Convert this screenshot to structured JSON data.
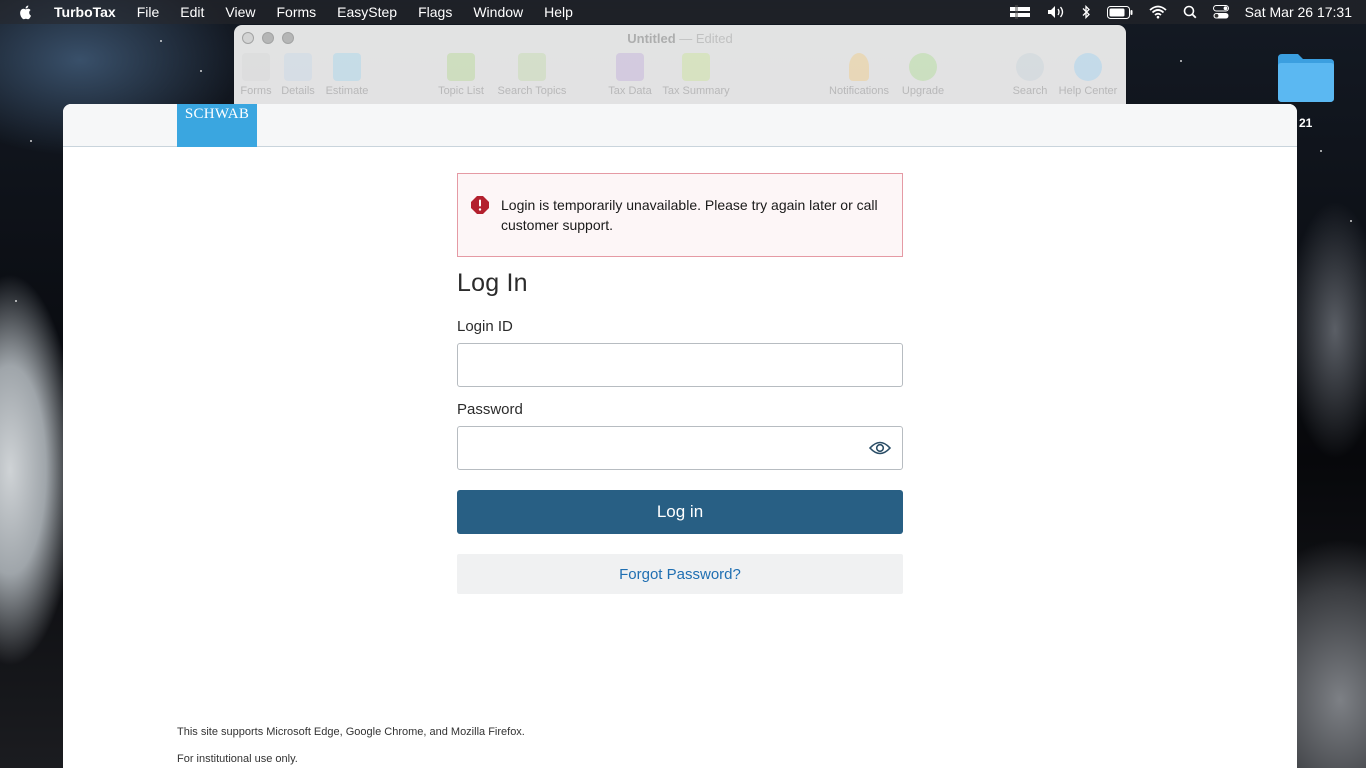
{
  "menubar": {
    "app_name": "TurboTax",
    "items": [
      "File",
      "Edit",
      "View",
      "Forms",
      "EasyStep",
      "Flags",
      "Window",
      "Help"
    ],
    "clock": "Sat Mar 26  17:31",
    "tray_icons": [
      "menu-extra-icon",
      "volume-icon",
      "bluetooth-icon",
      "battery-icon",
      "wifi-icon",
      "spotlight-icon",
      "control-center-icon"
    ]
  },
  "tt_window": {
    "title": "Untitled",
    "title_sep": " — ",
    "edited": "Edited",
    "toolbar": [
      "Forms",
      "Details",
      "Estimate",
      "Topic List",
      "Search Topics",
      "Tax Data",
      "Tax Summary",
      "Notifications",
      "Upgrade",
      "Search",
      "Help Center"
    ]
  },
  "desktop": {
    "folder_label": "21"
  },
  "page": {
    "logo_text": "SCHWAB",
    "alert_text": "Login is temporarily unavailable. Please try again later or call customer support.",
    "heading": "Log In",
    "login_id_label": "Login ID",
    "login_id_value": "",
    "password_label": "Password",
    "password_value": "",
    "login_button": "Log in",
    "forgot_button": "Forgot Password?",
    "footer_browsers": "This site supports Microsoft Edge, Google Chrome, and Mozilla Firefox.",
    "footer_institutional": "For institutional use only."
  },
  "colors": {
    "accent": "#285f84",
    "link": "#1f6fb2",
    "alert_border": "#e59aa4",
    "alert_icon": "#b3202e",
    "logo_bg": "#3aa6e0"
  }
}
